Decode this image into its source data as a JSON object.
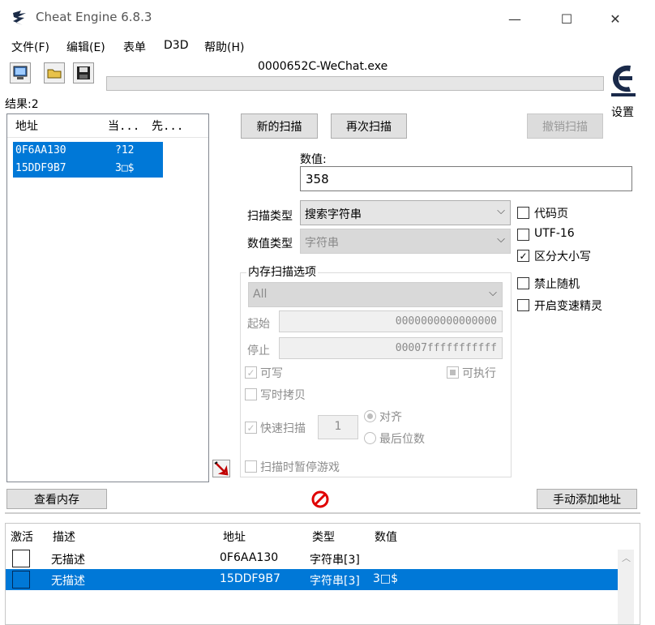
{
  "window": {
    "title": "Cheat Engine 6.8.3",
    "minimize": "—",
    "maximize": "☐",
    "close": "✕"
  },
  "menu": [
    "文件(F)",
    "编辑(E)",
    "表单",
    "D3D",
    "帮助(H)"
  ],
  "process": {
    "title": "0000652C-WeChat.exe"
  },
  "settings_label": "设置",
  "results": {
    "label": "结果:2",
    "columns": [
      "地址",
      "当...",
      "先..."
    ],
    "rows": [
      {
        "address": "0F6AA130",
        "current": "?12"
      },
      {
        "address": "15DDF9B7",
        "current": "3□$"
      }
    ]
  },
  "scan": {
    "new_scan": "新的扫描",
    "next_scan": "再次扫描",
    "undo_scan": "撤销扫描",
    "value_label": "数值:",
    "value": "358",
    "scan_type_label": "扫描类型",
    "scan_type_value": "搜索字符串",
    "value_type_label": "数值类型",
    "value_type_value": "字符串"
  },
  "options": {
    "codepage": "代码页",
    "utf16": "UTF-16",
    "case_sensitive": "区分大小写",
    "no_random": "禁止随机",
    "speedhack": "开启变速精灵"
  },
  "memory": {
    "group_title": "内存扫描选项",
    "region_value": "All",
    "start_label": "起始",
    "start_value": "0000000000000000",
    "stop_label": "停止",
    "stop_value": "00007fffffffffff",
    "writable": "可写",
    "executable": "可执行",
    "copy_on_write": "写时拷贝",
    "fast_scan": "快速扫描",
    "fast_scan_value": "1",
    "align": "对齐",
    "last_digits": "最后位数",
    "pause_game": "扫描时暂停游戏"
  },
  "bottom": {
    "view_memory": "查看内存",
    "add_address": "手动添加地址"
  },
  "table": {
    "columns": [
      "激活",
      "描述",
      "地址",
      "类型",
      "数值"
    ],
    "rows": [
      {
        "description": "无描述",
        "address": "0F6AA130",
        "type": "字符串[3]",
        "value": ""
      },
      {
        "description": "无描述",
        "address": "15DDF9B7",
        "type": "字符串[3]",
        "value": "3□$"
      }
    ]
  },
  "colors": {
    "selection": "#0078d7",
    "logo": "#1a2a4a"
  }
}
